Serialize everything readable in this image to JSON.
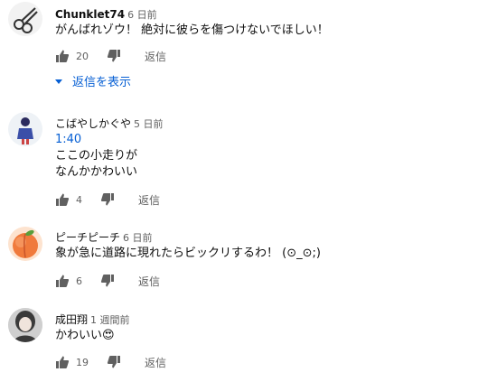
{
  "comments": [
    {
      "author": "Chunklet74",
      "time": "6 日前",
      "lines": [
        "がんばれゾウ！ 絶対に彼らを傷つけないでほしい！"
      ],
      "likes": "20",
      "reply_label": "返信",
      "show_replies_label": "返信を表示",
      "avatar_icon": "scissors-icon"
    },
    {
      "author": "こばやしかぐや",
      "time": "5 日前",
      "timestamp_link": "1:40",
      "lines": [
        "ここの小走りが",
        "なんかかわいい"
      ],
      "likes": "4",
      "reply_label": "返信",
      "avatar_icon": "figure-avatar-icon"
    },
    {
      "author": "ピーチピーチ",
      "time": "6 日前",
      "lines": [
        "象が急に道路に現れたらビックリするわ！ (⊙_⊙;)"
      ],
      "likes": "6",
      "reply_label": "返信",
      "avatar_icon": "peach-icon"
    },
    {
      "author": "成田翔",
      "time": "1 週間前",
      "lines": [
        "かわいい"
      ],
      "emoji": "😍",
      "likes": "19",
      "reply_label": "返信",
      "avatar_icon": "girl-portrait-icon"
    }
  ],
  "colors": {
    "link": "#065fd4",
    "meta": "#606060",
    "icon": "#606060",
    "text": "#0f0f0f"
  }
}
